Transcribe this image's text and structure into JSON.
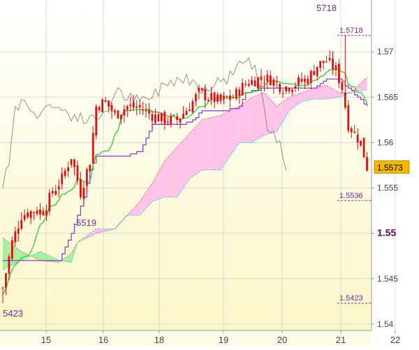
{
  "chart_data": {
    "type": "line",
    "title": "",
    "xlabel": "",
    "ylabel": "",
    "x_tick_labels": [
      "15",
      "16",
      "18",
      "19",
      "20",
      "21",
      "22"
    ],
    "y_tick_labels": [
      {
        "value": 1.54,
        "label": "1.54"
      },
      {
        "value": 1.545,
        "label": "1.545"
      },
      {
        "value": 1.55,
        "label": "1.55",
        "bold": true
      },
      {
        "value": 1.555,
        "label": "1.555"
      },
      {
        "value": 1.56,
        "label": "1.56"
      },
      {
        "value": 1.565,
        "label": "1.565"
      },
      {
        "value": 1.57,
        "label": "1.57"
      }
    ],
    "ylim": [
      1.5393,
      1.5757
    ],
    "annotations": [
      {
        "text": "5718",
        "role": "high"
      },
      {
        "text": "5519",
        "role": "swing"
      },
      {
        "text": "5423",
        "role": "low"
      }
    ],
    "levels": [
      {
        "value": 1.5718,
        "label": "1.5718"
      },
      {
        "value": 1.5536,
        "label": "1.5536"
      },
      {
        "value": 1.5423,
        "label": "1.5423"
      }
    ],
    "last_price": {
      "value": 1.5573,
      "label": "1.5573"
    },
    "colors": {
      "candles": "#dd1111",
      "tenkan": "#22cc22",
      "kijun": "#8833cc",
      "chikou": "#444444",
      "cloud_bear_fill": "#ffc4e8",
      "cloud_bull_fill": "#a8f0a0",
      "span_a": "#ee5566",
      "span_b": "#22bbee",
      "level": "#9933aa",
      "price_box": "#f2b800",
      "label_text": "#7a2a99"
    }
  }
}
